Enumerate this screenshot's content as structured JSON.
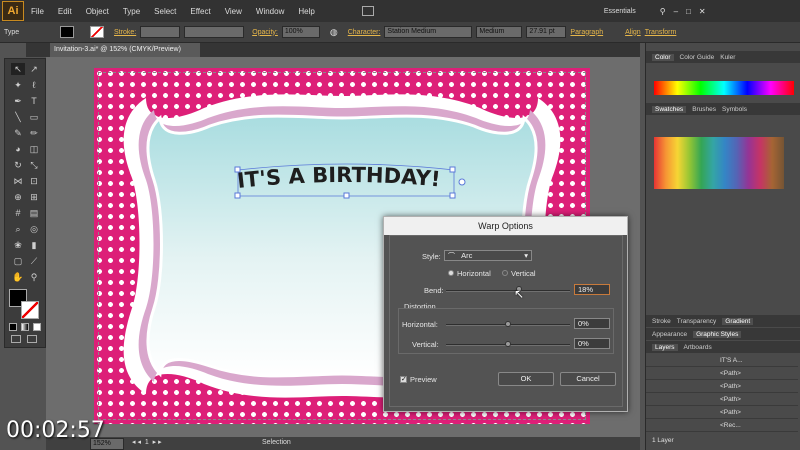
{
  "app": {
    "logo": "Ai"
  },
  "menubar": {
    "items": [
      "File",
      "Edit",
      "Object",
      "Type",
      "Select",
      "Effect",
      "View",
      "Window",
      "Help"
    ],
    "workspace": "Essentials"
  },
  "control_bar": {
    "type_label": "Type",
    "stroke_label": "Stroke:",
    "opacity_label": "Opacity:",
    "opacity_value": "100%",
    "character_label": "Character:",
    "font_family": "Station Medium",
    "font_style": "Medium",
    "font_size": "27.91 pt",
    "paragraph_label": "Paragraph",
    "align_label": "Align",
    "transform_label": "Transform"
  },
  "document": {
    "tab_title": "Invitation-3.ai* @ 152% (CMYK/Preview)",
    "zoom": "152%",
    "status": "Selection"
  },
  "artwork": {
    "headline": "IT'S A BIRTHDAY!",
    "colors": {
      "background": "#dd1f78",
      "dots": "#ffffff",
      "frame_outline": "#d9a7cc",
      "label_top": "#a9dde0"
    }
  },
  "dialog": {
    "title": "Warp Options",
    "style_label": "Style:",
    "style_value": "Arc",
    "orientation": {
      "horizontal": "Horizontal",
      "vertical": "Vertical",
      "selected": "Horizontal"
    },
    "bend_label": "Bend:",
    "bend_value": "18%",
    "bend": 18,
    "distortion_label": "Distortion",
    "horizontal_label": "Horizontal:",
    "horizontal_value": "0%",
    "horizontal": 0,
    "vertical_label": "Vertical:",
    "vertical_value": "0%",
    "vertical": 0,
    "preview_label": "Preview",
    "preview_checked": true,
    "ok_label": "OK",
    "cancel_label": "Cancel"
  },
  "panels": {
    "color_tabs": [
      "Color",
      "Color Guide",
      "Kuler"
    ],
    "swatch_tabs": [
      "Swatches",
      "Brushes",
      "Symbols"
    ],
    "mid_tabs": [
      "Stroke",
      "Transparency",
      "Gradient"
    ],
    "style_tabs": [
      "Appearance",
      "Graphic Styles"
    ],
    "layer_tabs": [
      "Layers",
      "Artboards"
    ],
    "layers": [
      "IT'S A...",
      "<Path>",
      "<Path>",
      "<Path>",
      "<Path>",
      "<Rec..."
    ],
    "layer_count": "1 Layer"
  },
  "video": {
    "timestamp": "00:02:57"
  }
}
